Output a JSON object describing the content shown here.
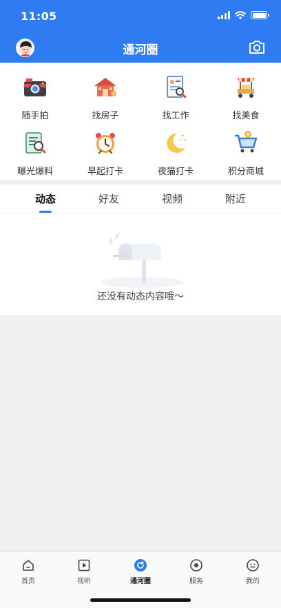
{
  "status_bar": {
    "time": "11:05"
  },
  "header": {
    "title": "通河圈"
  },
  "grid": {
    "items": [
      {
        "label": "随手拍",
        "icon": "camera-icon"
      },
      {
        "label": "找房子",
        "icon": "house-icon"
      },
      {
        "label": "找工作",
        "icon": "resume-icon"
      },
      {
        "label": "找美食",
        "icon": "food-cart-icon"
      },
      {
        "label": "曝光爆料",
        "icon": "report-icon"
      },
      {
        "label": "早起打卡",
        "icon": "alarm-clock-icon"
      },
      {
        "label": "夜猫打卡",
        "icon": "moon-icon"
      },
      {
        "label": "积分商城",
        "icon": "shopping-cart-icon"
      }
    ]
  },
  "tabs": [
    {
      "label": "动态",
      "active": true
    },
    {
      "label": "好友",
      "active": false
    },
    {
      "label": "视频",
      "active": false
    },
    {
      "label": "附近",
      "active": false
    }
  ],
  "feed": {
    "empty_message": "还没有动态内容哦～"
  },
  "bottom_nav": {
    "items": [
      {
        "label": "首页",
        "icon": "home-icon",
        "active": false
      },
      {
        "label": "视听",
        "icon": "play-icon",
        "active": false
      },
      {
        "label": "通河圈",
        "icon": "circle-refresh-icon",
        "active": true
      },
      {
        "label": "服务",
        "icon": "service-icon",
        "active": false
      },
      {
        "label": "我的",
        "icon": "profile-icon",
        "active": false
      }
    ]
  },
  "colors": {
    "brand_blue": "#2f7bf2",
    "page_bg": "#f0f0f0"
  }
}
